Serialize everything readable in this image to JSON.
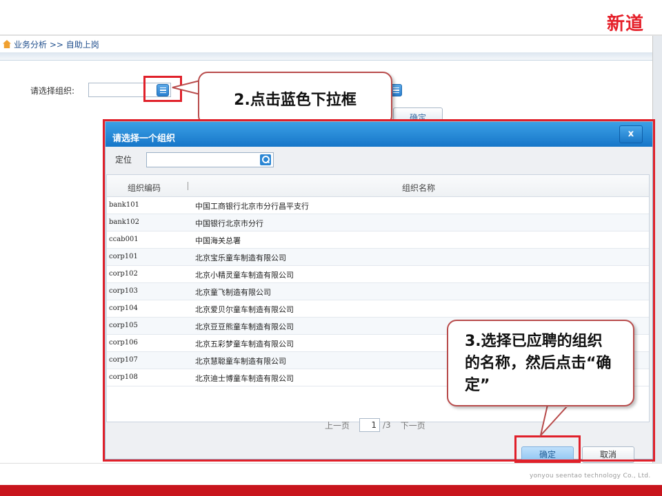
{
  "brand": {
    "logo": "新道",
    "footer": "yonyou seentao technology Co., Ltd."
  },
  "breadcrumb": {
    "text": "业务分析 >> 自助上岗"
  },
  "form": {
    "org_label": "请选择组织:",
    "confirm_label": "确定"
  },
  "callouts": {
    "step2": "2.点击蓝色下拉框",
    "step3": "3.选择已应聘的组织的名称，然后点击“确定”"
  },
  "dialog": {
    "title": "请选择一个组织",
    "close_label": "x",
    "locate_label": "定位",
    "locate_value": "",
    "columns": [
      "组织编码",
      "组织名称"
    ],
    "rows": [
      {
        "code": "bank101",
        "name": "中国工商银行北京市分行昌平支行"
      },
      {
        "code": "bank102",
        "name": "中国银行北京市分行"
      },
      {
        "code": "ccab001",
        "name": "中国海关总署"
      },
      {
        "code": "corp101",
        "name": "北京宝乐童车制造有限公司"
      },
      {
        "code": "corp102",
        "name": "北京小精灵童车制造有限公司"
      },
      {
        "code": "corp103",
        "name": "北京童飞制造有限公司"
      },
      {
        "code": "corp104",
        "name": "北京爱贝尔童车制造有限公司"
      },
      {
        "code": "corp105",
        "name": "北京豆豆熊童车制造有限公司"
      },
      {
        "code": "corp106",
        "name": "北京五彩梦童车制造有限公司"
      },
      {
        "code": "corp107",
        "name": "北京慧聪童车制造有限公司"
      },
      {
        "code": "corp108",
        "name": "北京迪士博童车制造有限公司"
      }
    ],
    "pager": {
      "prev": "上一页",
      "page": "1",
      "total": "/3",
      "next": "下一页"
    },
    "ok_label": "确定",
    "cancel_label": "取消"
  },
  "colors": {
    "accent_red": "#e0202a",
    "header_blue": "#1676c8",
    "bottom_bar": "#c8151d"
  }
}
